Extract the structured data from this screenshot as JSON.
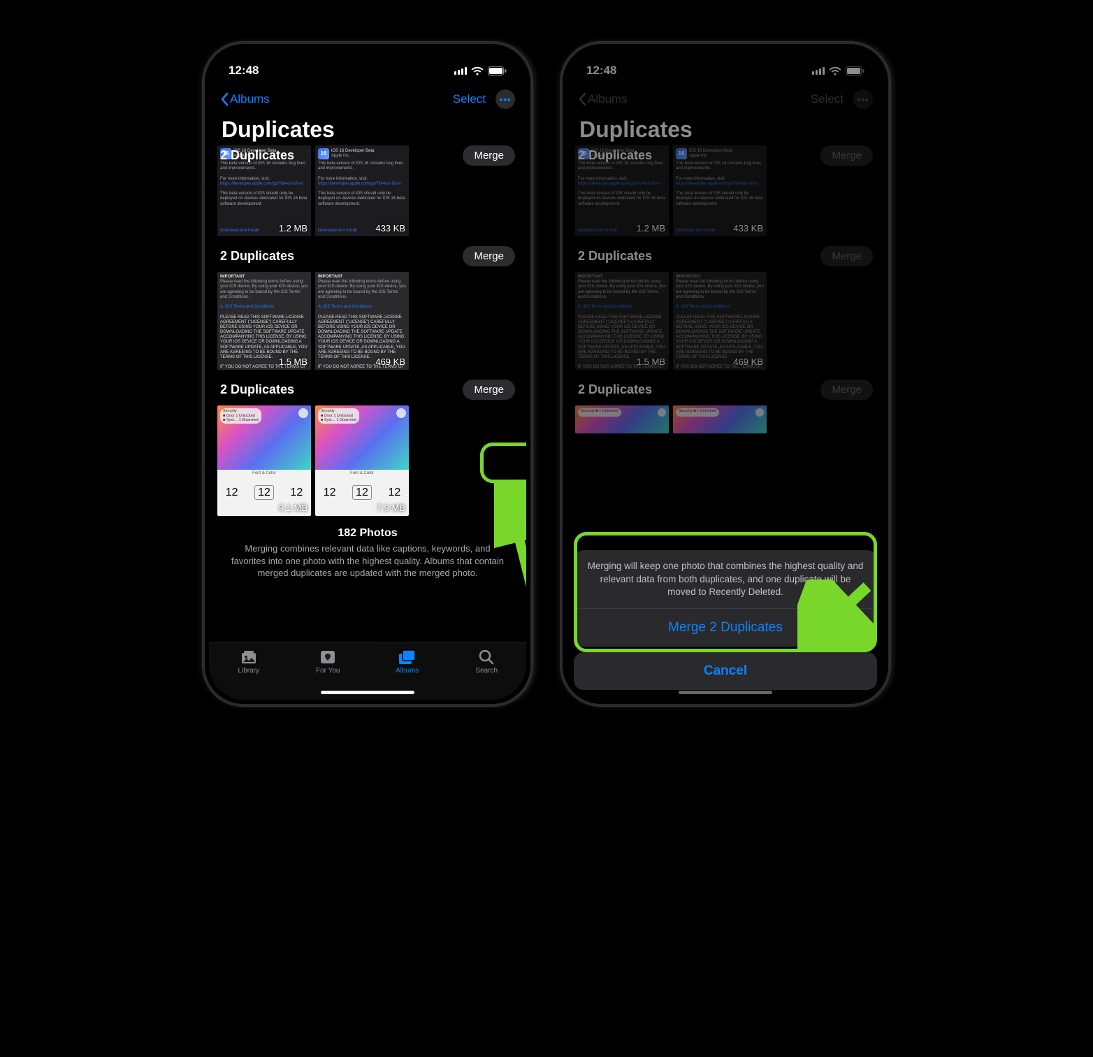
{
  "status": {
    "time": "12:48"
  },
  "nav": {
    "back": "Albums",
    "select": "Select"
  },
  "title": "Duplicates",
  "merge_label": "Merge",
  "groups": [
    {
      "label": "2 Duplicates",
      "sizes": [
        "1.2 MB",
        "433 KB"
      ]
    },
    {
      "label": "2 Duplicates",
      "sizes": [
        "1.5 MB",
        "469 KB"
      ]
    },
    {
      "label": "2 Duplicates",
      "sizes": [
        "9.1 MB",
        "7.9 MB"
      ]
    }
  ],
  "thumb_text": {
    "ios_title": "iOS 16 Developer Beta",
    "ios_sub": "Apple Inc.",
    "ios_body1": "This beta version of iOS 16 contains bug fixes and improvements.",
    "ios_info": "For more information, visit:",
    "ios_link": "https://developer.apple.com/go/?id=ios-16-rn",
    "ios_body2": "This beta version of iOS should only be deployed on devices dedicated for iOS 16 beta software development.",
    "ios_dl": "Download and Install",
    "terms_head": "IMPORTANT",
    "terms_p1": "Please read the following terms before using your iOS device. By using your iOS device, you are agreeing to be bound by the iOS Terms and Conditions.",
    "terms_link": "A. iOS Terms and Conditions",
    "terms_p2": "PLEASE READ THIS SOFTWARE LICENSE AGREEMENT (\"LICENSE\") CAREFULLY BEFORE USING YOUR iOS DEVICE OR DOWNLOADING THE SOFTWARE UPDATE ACCOMPANYING THIS LICENSE. BY USING YOUR iOS DEVICE OR DOWNLOADING A SOFTWARE UPDATE, AS APPLICABLE, YOU ARE AGREEING TO BE BOUND BY THE TERMS OF THIS LICENSE.",
    "terms_p3": "IF YOU DO NOT AGREE TO THE TERMS OF THIS LICENSE, DO NOT USE THE iOS DEVICE OR DOWNLOAD THE SOFTWARE UPDATE. IF YOU HAVE RECENTLY PURCHASED AN iOS DEVICE AND YOU DO NOT AGREE",
    "fc_label": "Font & Color",
    "fc_num": "12",
    "sec_label": "Security",
    "sec_door": "Door",
    "sec_sys": "Syst…",
    "sec_unlocked": "1 Unlocked",
    "sec_disarmed": "1 Disarmed"
  },
  "footer": {
    "count": "182 Photos",
    "desc": "Merging combines relevant data like captions, keywords, and favorites into one photo with the highest quality. Albums that contain merged duplicates are updated with the merged photo."
  },
  "tabs": {
    "library": "Library",
    "for_you": "For You",
    "albums": "Albums",
    "search": "Search"
  },
  "sheet": {
    "msg": "Merging will keep one photo that combines the highest quality and relevant data from both duplicates, and one duplicate will be moved to Recently Deleted.",
    "action": "Merge 2 Duplicates",
    "cancel": "Cancel"
  }
}
